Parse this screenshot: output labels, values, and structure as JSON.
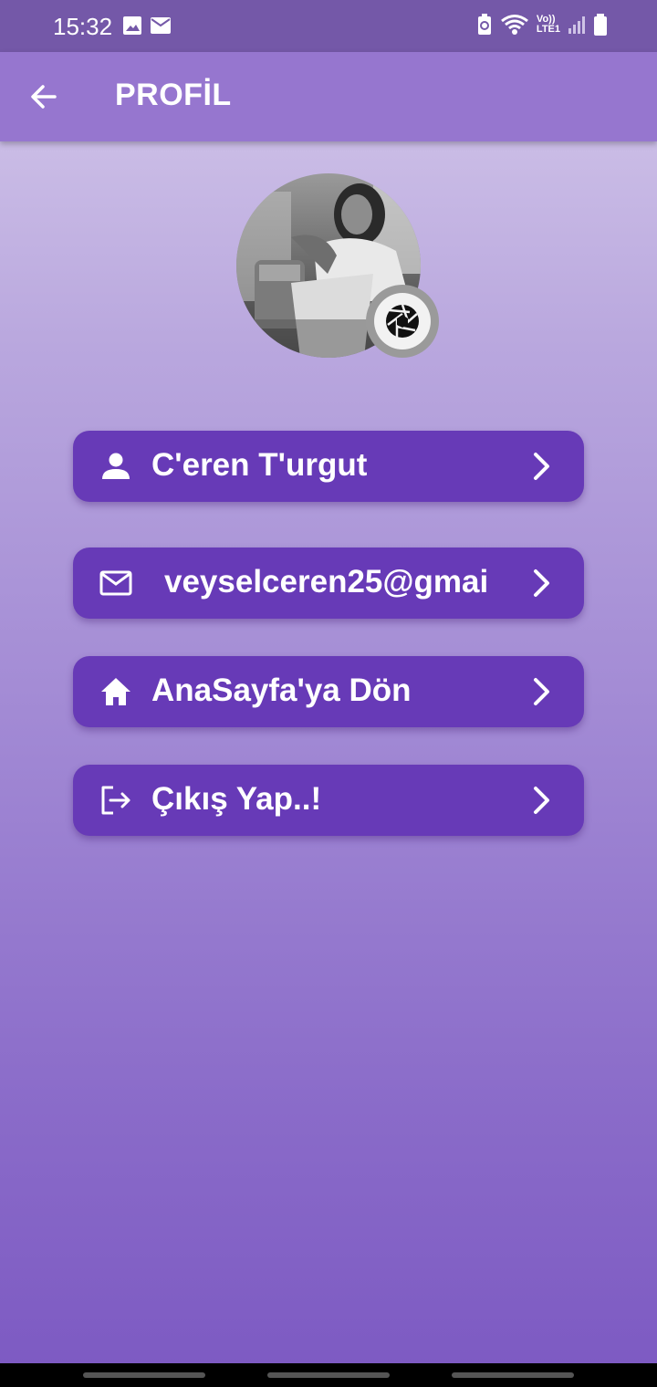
{
  "status_bar": {
    "time": "15:32",
    "icons": [
      "image-icon",
      "mail-icon",
      "battery-saver-icon",
      "wifi-icon",
      "volte-icon",
      "signal-icon",
      "battery-icon"
    ],
    "volte_label_top": "Vo))",
    "volte_label_bottom": "LTE1"
  },
  "app_bar": {
    "title": "PROFİL",
    "back_icon": "arrow-back-icon"
  },
  "profile": {
    "avatar": "profile-photo",
    "camera_icon": "camera-aperture-icon"
  },
  "menu": {
    "items": [
      {
        "label": "C'eren T'urgut",
        "icon": "person-icon"
      },
      {
        "label": "veyselceren25@gmai",
        "icon": "mail-outline-icon"
      },
      {
        "label": "AnaSayfa'ya Dön",
        "icon": "home-icon"
      },
      {
        "label": "Çıkış Yap..!",
        "icon": "logout-icon"
      }
    ]
  },
  "colors": {
    "app_bar": "#9676cf",
    "status_bar": "#7458a8",
    "button": "#673ab7",
    "gradient_top": "#d6cbeb",
    "gradient_bottom": "#7c59c2"
  }
}
